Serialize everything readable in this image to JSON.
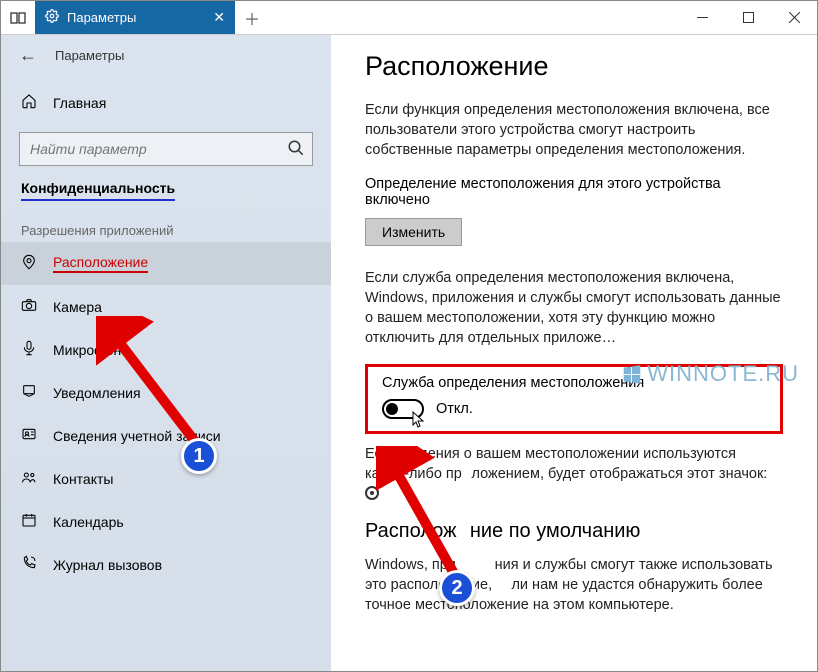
{
  "titlebar": {
    "tab_label": "Параметры"
  },
  "header": {
    "title": "Параметры"
  },
  "sidebar": {
    "home": "Главная",
    "search_placeholder": "Найти параметр",
    "category": "Конфиденциальность",
    "section_heading": "Разрешения приложений",
    "items": [
      {
        "label": "Расположение",
        "active": true
      },
      {
        "label": "Камера"
      },
      {
        "label": "Микрофон"
      },
      {
        "label": "Уведомления"
      },
      {
        "label": "Сведения учетной записи"
      },
      {
        "label": "Контакты"
      },
      {
        "label": "Календарь"
      },
      {
        "label": "Журнал вызовов"
      }
    ]
  },
  "content": {
    "heading": "Расположение",
    "para1": "Если функция определения местоположения включена, все пользователи этого устройства смогут настроить собственные параметры определения местоположения.",
    "status": "Определение местоположения для этого устройства включено",
    "change_btn": "Изменить",
    "para2_a": "Если служба определения местоположения включена, Windows, приложения и службы смогут использовать данные о вашем местоположении, хотя эту функцию можно отключить для отдельных приложе",
    "toggle_title": "Служба определения местоположения",
    "toggle_state": "Откл.",
    "para3_a": "Есл",
    "para3_b": "дения о вашем местоположении используются каким-либо пр",
    "para3_c": "ложением, будет отображаться этот значок:",
    "heading2": "Располож",
    "heading2b": "ние по умолчанию",
    "para4_a": "Windows, при",
    "para4_b": "ния и службы смогут также использовать это расположение,",
    "para4_c": "ли нам не удастся обнаружить более точное местоположение на этом компьютере."
  },
  "watermark": {
    "text": "WINNOTE.RU"
  },
  "annotations": {
    "b1": "1",
    "b2": "2"
  }
}
